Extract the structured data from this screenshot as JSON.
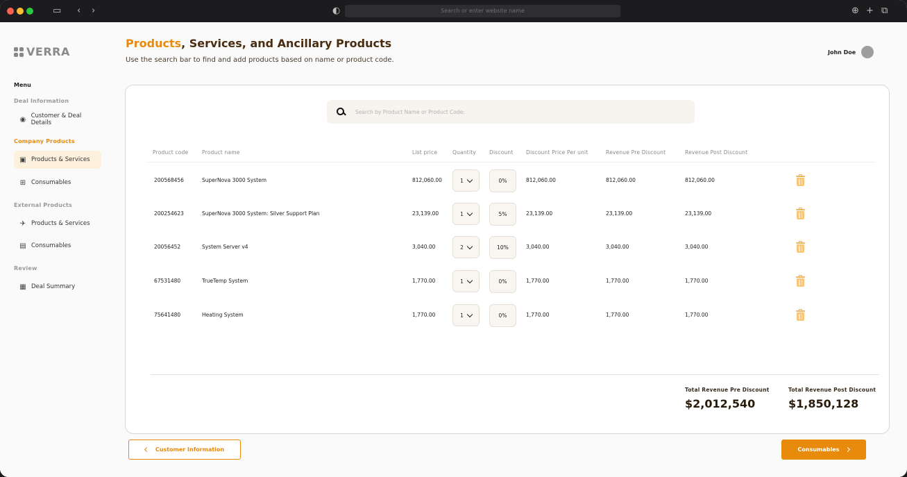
{
  "browser": {
    "address_placeholder": "Search or enter website name"
  },
  "brand": {
    "name": "VERRA"
  },
  "user": {
    "name": "John Doe"
  },
  "sidebar": {
    "menu_title": "Menu",
    "sections": [
      {
        "label": "Deal Information",
        "items": [
          {
            "label": "Customer & Deal Details",
            "icon": "user-circle-icon"
          }
        ]
      },
      {
        "label": "Company Products",
        "items": [
          {
            "label": "Products & Services",
            "icon": "window-icon"
          },
          {
            "label": "Consumables",
            "icon": "grid-box-icon"
          }
        ]
      },
      {
        "label": "External Products",
        "items": [
          {
            "label": "Products & Services",
            "icon": "satellite-icon"
          },
          {
            "label": "Consumables",
            "icon": "devices-icon"
          }
        ]
      },
      {
        "label": "Review",
        "items": [
          {
            "label": "Deal Summary",
            "icon": "clipboard-icon"
          }
        ]
      }
    ],
    "active_item": "Company Products / Products & Services"
  },
  "page": {
    "title_accent": "Products",
    "title_rest": ", Services, and Ancillary Products",
    "subtitle": "Use the search bar to find and add products based on name or product code."
  },
  "search": {
    "placeholder": "Search by Product Name or Product Code:"
  },
  "table": {
    "columns": [
      "Product code",
      "Product name",
      "List price",
      "Quantity",
      "Discount",
      "Discount Price Per unit",
      "Revenue Pre Discount",
      "Revenue Post Discount"
    ],
    "rows": [
      {
        "code": "200568456",
        "name": "SuperNova 3000 System",
        "list_price": "812,060.00",
        "quantity": "1",
        "discount": "0%",
        "discount_price": "812,060.00",
        "rev_pre": "812,060.00",
        "rev_post": "812,060.00"
      },
      {
        "code": "200254623",
        "name": "SuperNova 3000 System: Silver Support Plan",
        "list_price": "23,139.00",
        "quantity": "1",
        "discount": "5%",
        "discount_price": "23,139.00",
        "rev_pre": "23,139.00",
        "rev_post": "23,139.00"
      },
      {
        "code": "20056452",
        "name": "System Server v4",
        "list_price": "3,040.00",
        "quantity": "2",
        "discount": "10%",
        "discount_price": "3,040.00",
        "rev_pre": "3,040.00",
        "rev_post": "3,040.00"
      },
      {
        "code": "67531480",
        "name": "TrueTemp System",
        "list_price": "1,770.00",
        "quantity": "1",
        "discount": "0%",
        "discount_price": "1,770.00",
        "rev_pre": "1,770.00",
        "rev_post": "1,770.00"
      },
      {
        "code": "75641480",
        "name": "Heating System",
        "list_price": "1,770.00",
        "quantity": "1",
        "discount": "0%",
        "discount_price": "1,770.00",
        "rev_pre": "1,770.00",
        "rev_post": "1,770.00"
      }
    ]
  },
  "totals": {
    "pre_label": "Total Revenue Pre Discount",
    "pre_value": "$2,012,540",
    "post_label": "Total Revenue Post Discount",
    "post_value": "$1,850,128"
  },
  "footer": {
    "back_label": "Customer Information",
    "next_label": "Consumables"
  },
  "colors": {
    "accent": "#e88a0c",
    "active_bg": "#fdf0dc",
    "title_dark": "#4a2d10"
  }
}
